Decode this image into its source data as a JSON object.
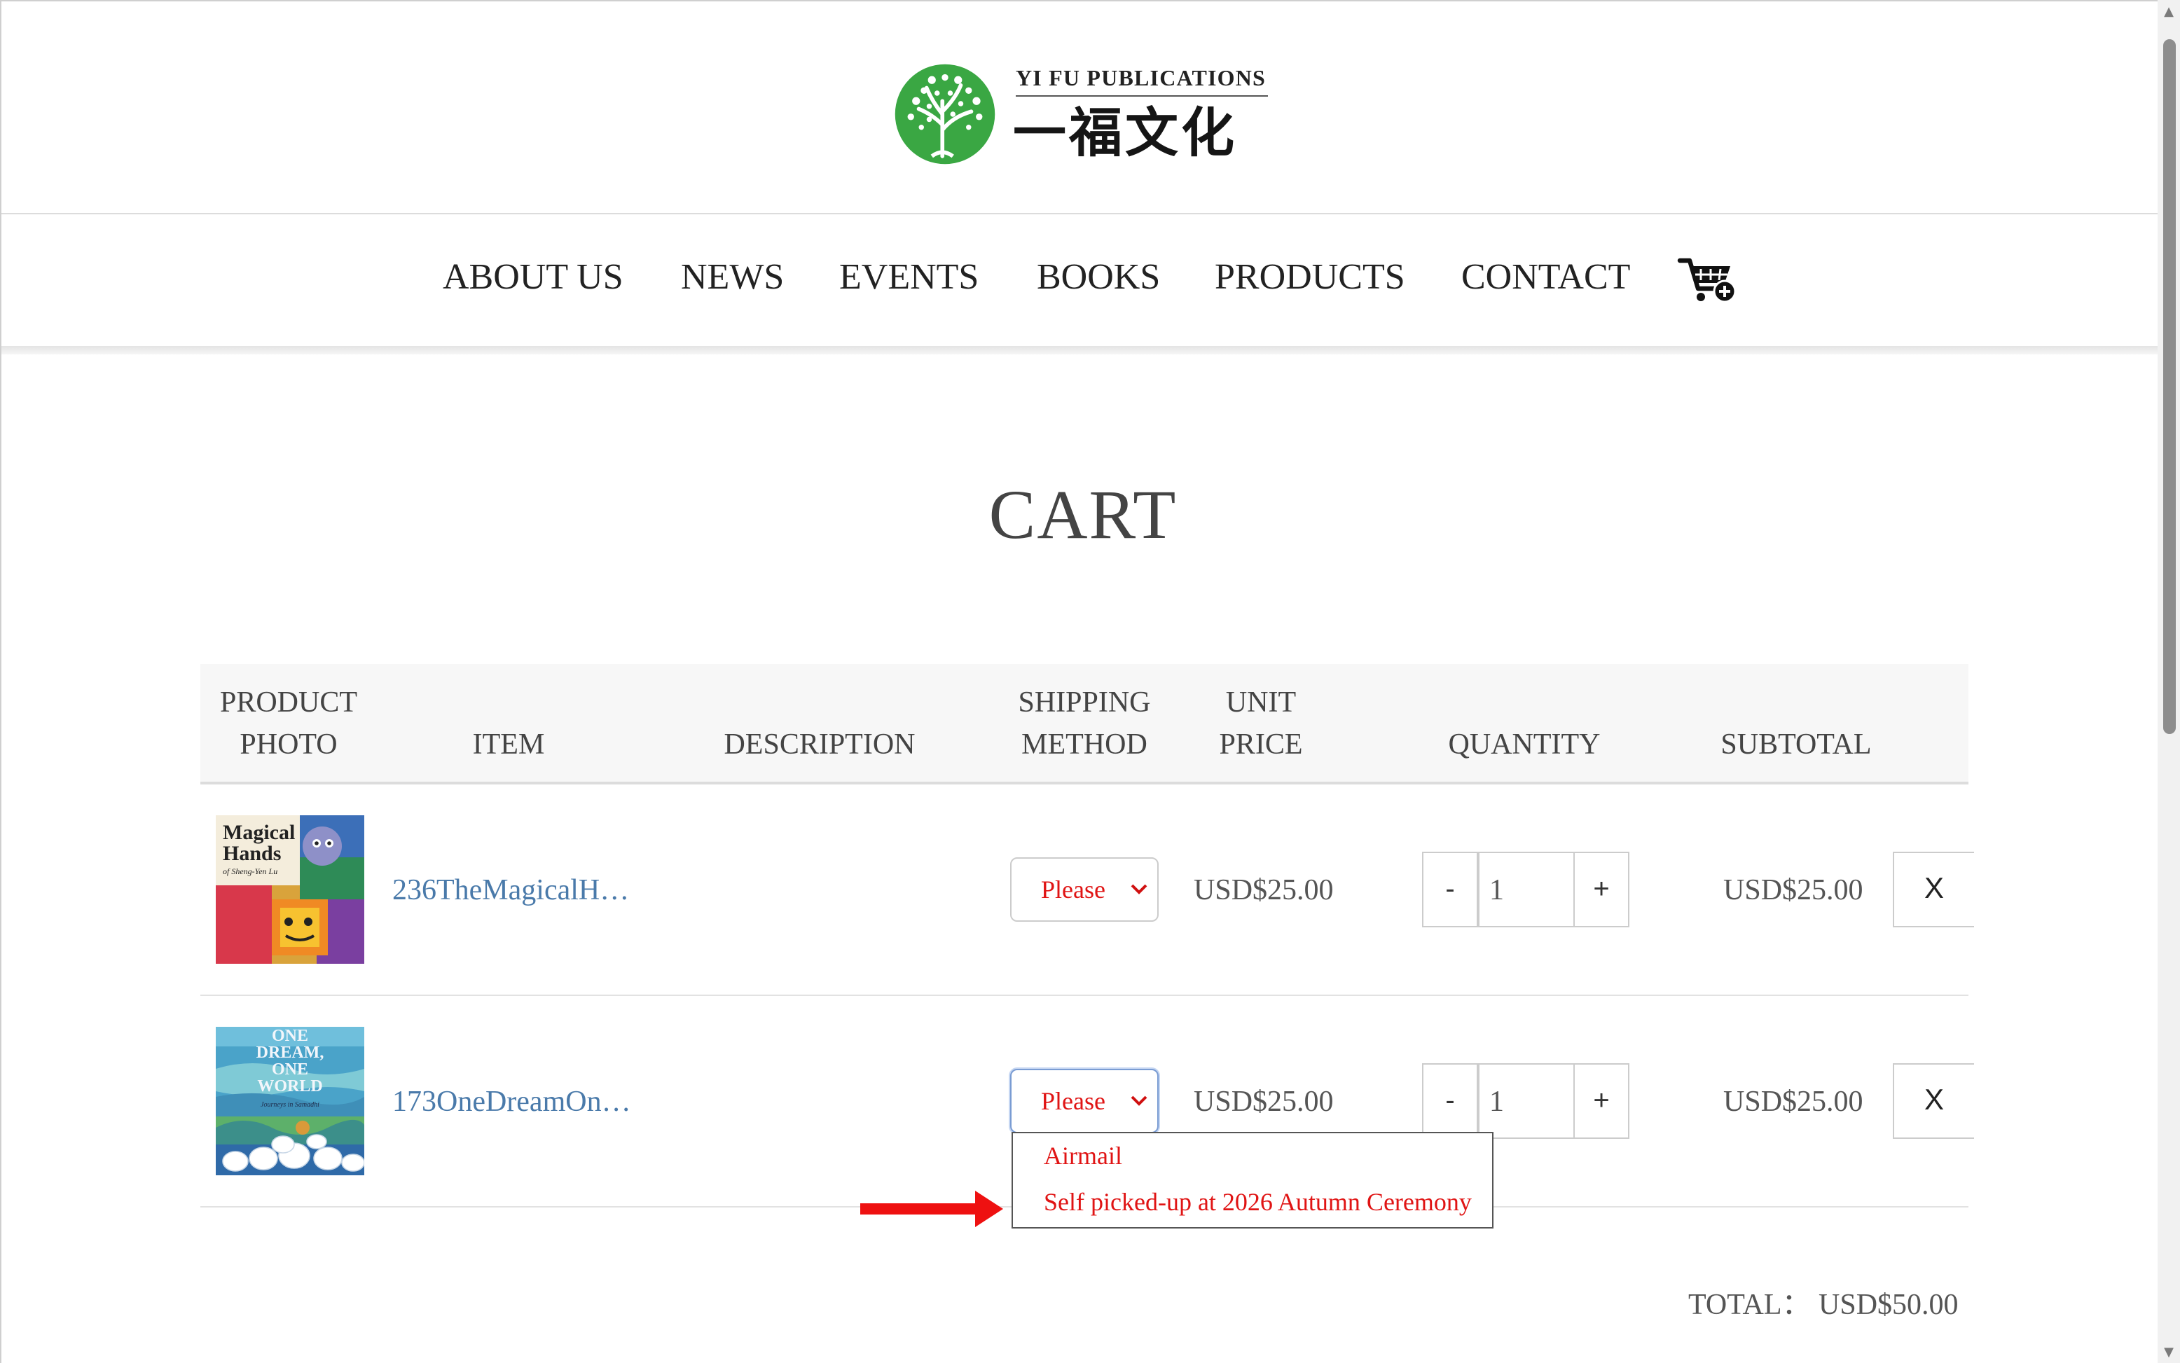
{
  "logo": {
    "english": "YI FU PUBLICATIONS",
    "chinese": "一福文化",
    "tree_color": "#3aa743"
  },
  "nav": {
    "items": [
      "ABOUT US",
      "NEWS",
      "EVENTS",
      "BOOKS",
      "PRODUCTS",
      "CONTACT"
    ],
    "cart_icon": "shopping-cart-plus-icon"
  },
  "page": {
    "title": "CART"
  },
  "table": {
    "headers": {
      "product_photo_line1": "PRODUCT",
      "product_photo_line2": "PHOTO",
      "item": "ITEM",
      "description": "DESCRIPTION",
      "shipping_line1": "SHIPPING",
      "shipping_line2": "METHOD",
      "unit_price_line1": "UNIT",
      "unit_price_line2": "PRICE",
      "quantity": "QUANTITY",
      "subtotal": "SUBTOTAL"
    },
    "rows": [
      {
        "cover_title_line1": "Magical",
        "cover_title_line2": "Hands",
        "cover_author": "of Sheng-Yen Lu",
        "item": "236TheMagicalH…",
        "description": "",
        "shipping_selected": "Please",
        "unit_price": "USD$25.00",
        "qty_minus": "-",
        "quantity": "1",
        "qty_plus": "+",
        "subtotal": "USD$25.00",
        "remove": "X"
      },
      {
        "cover_title_line1": "ONE",
        "cover_title_line2": "DREAM,",
        "cover_title_line3": "ONE",
        "cover_title_line4": "WORLD",
        "cover_subtitle": "Journeys in Samadhi",
        "item": "173OneDreamOn…",
        "description": "",
        "shipping_selected": "Please",
        "unit_price": "USD$25.00",
        "qty_minus": "-",
        "quantity": "1",
        "qty_plus": "+",
        "subtotal": "USD$25.00",
        "remove": "X"
      }
    ]
  },
  "shipping_dropdown": {
    "options": [
      "Airmail",
      "Self picked-up at 2026 Autumn Ceremony"
    ],
    "option_color": "#e01414"
  },
  "annotation": {
    "arrow_color": "#ee1111"
  },
  "total": {
    "label": "TOTAL：",
    "amount": "USD$50.00"
  }
}
